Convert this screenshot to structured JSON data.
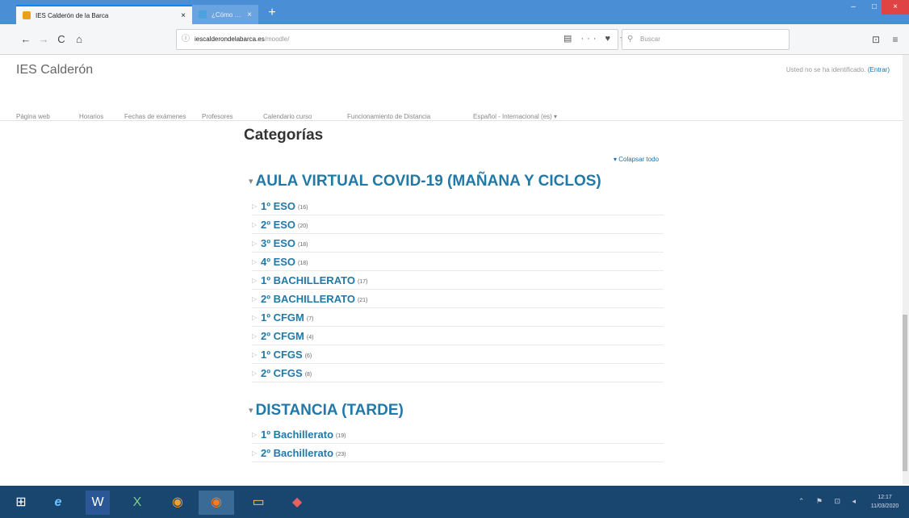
{
  "browser": {
    "tabs": [
      {
        "title": "IES Calderón de la Barca",
        "close": "×",
        "favicon_color": "#e8a21a"
      },
      {
        "title": "¿Cómo capturar la pantall…",
        "close": "×",
        "favicon_color": "#4aa3df"
      }
    ],
    "new_tab": "+",
    "window_controls": {
      "minimize": "–",
      "maximize": "□",
      "close": "×"
    },
    "nav": {
      "back": "←",
      "forward": "→",
      "reload": "C",
      "home": "⌂"
    },
    "url": {
      "info": "ⓘ",
      "domain": "iescalderondelabarca.es",
      "path": "/moodle/"
    },
    "url_icons": "▤ ··· ♥ ☆",
    "search": {
      "icon": "⚲",
      "placeholder": "Buscar"
    },
    "right_icons": {
      "library": "⊡",
      "menu": "≡"
    }
  },
  "site": {
    "title": "IES Calderón",
    "login_text": "Usted no se ha identificado.",
    "login_link": "(Entrar)"
  },
  "menu": [
    "Página web",
    "Horarios",
    "Fechas de exámenes",
    "Profesores",
    "Calendario curso",
    "Funcionamiento de Distancia",
    "Español - Internacional (es) ▾"
  ],
  "main": {
    "heading": "Categorías",
    "collapse_all": "▾ Colapsar todo",
    "groups": [
      {
        "title": "AULA VIRTUAL COVID-19 (MAÑANA Y CICLOS)",
        "expander": "▾",
        "items": [
          {
            "name": "1º ESO",
            "count": "(16)"
          },
          {
            "name": "2º ESO",
            "count": "(20)"
          },
          {
            "name": "3º ESO",
            "count": "(18)"
          },
          {
            "name": "4º ESO",
            "count": "(18)"
          },
          {
            "name": "1º BACHILLERATO",
            "count": "(17)"
          },
          {
            "name": "2º BACHILLERATO",
            "count": "(21)"
          },
          {
            "name": "1º CFGM",
            "count": "(7)"
          },
          {
            "name": "2º CFGM",
            "count": "(4)"
          },
          {
            "name": "1º CFGS",
            "count": "(6)"
          },
          {
            "name": "2º CFGS",
            "count": "(8)"
          }
        ]
      },
      {
        "title": "DISTANCIA (TARDE)",
        "expander": "▾",
        "items": [
          {
            "name": "1º Bachillerato",
            "count": "(19)"
          },
          {
            "name": "2º Bachillerato",
            "count": "(23)"
          }
        ]
      }
    ],
    "bullet": "▷"
  },
  "taskbar": {
    "start": "⊞",
    "apps": [
      "e",
      "W",
      "X",
      "◉",
      "◉",
      "▭",
      "◆"
    ],
    "tray": "⌃ ⚑ ⊡ ◂",
    "time": "12:17",
    "date": "11/03/2020"
  }
}
